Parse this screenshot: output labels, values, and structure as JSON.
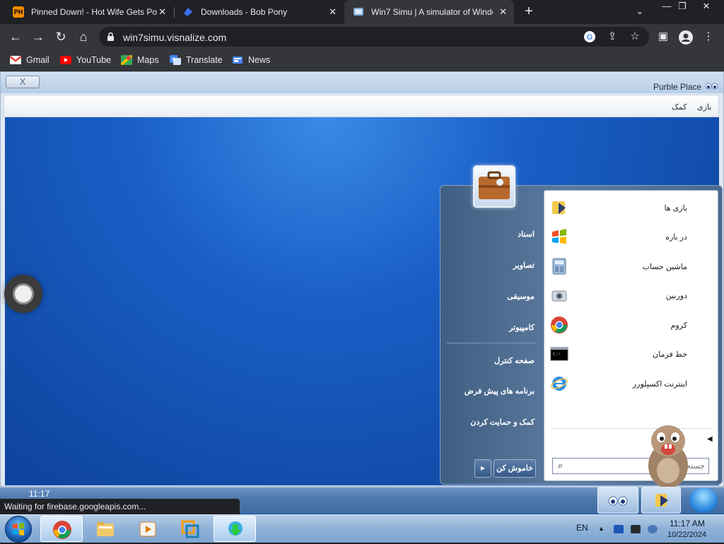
{
  "browser": {
    "tabs": [
      {
        "favicon": "pornhub-favicon",
        "title": "Pinned Down! - Hot Wife Gets Po",
        "active": false
      },
      {
        "favicon": "tumbleweed-favicon",
        "title": "Downloads - Bob Pony",
        "active": false
      },
      {
        "favicon": "win7simu-favicon",
        "title": "Win7 Simu | A simulator of Windo",
        "active": true
      }
    ],
    "new_tab": "+",
    "url": "win7simu.visnalize.com",
    "bookmarks": [
      "Gmail",
      "YouTube",
      "Maps",
      "Translate",
      "News"
    ],
    "status_text": "Waiting for firebase.googleapis.com..."
  },
  "game": {
    "close_label": "X",
    "title": "Purble Place",
    "menu": [
      "بازی",
      "کمک"
    ]
  },
  "start_menu": {
    "programs": [
      {
        "label": "بازی ها",
        "icon": "games-icon"
      },
      {
        "label": "در باره",
        "icon": "windows-flag-icon"
      },
      {
        "label": "ماشین حساب",
        "icon": "calculator-icon"
      },
      {
        "label": "دوربین",
        "icon": "camera-icon"
      },
      {
        "label": "کروم",
        "icon": "chrome-icon"
      },
      {
        "label": "خط فرمان",
        "icon": "cmd-icon"
      },
      {
        "label": "اینترنت اکسپلورر",
        "icon": "ie-icon"
      }
    ],
    "right_items": [
      "اسناد",
      "تصاویر",
      "موسیقی",
      "کامپیوتر",
      "صفحه کنترل",
      "برنامه های پیش فرض",
      "کمک و حمایت کردن"
    ],
    "search_placeholder": "جستجو برنامه ها",
    "shutdown_label": "خاموش کن"
  },
  "inner_taskbar": {
    "time": "11:17"
  },
  "taskbar": {
    "language": "EN",
    "time": "11:17 AM",
    "date": "10/22/2024"
  },
  "colors": {
    "chrome_dark": "#202124",
    "chrome_toolbar": "#35363a",
    "desktop_blue": "#1a5fc7",
    "start_menu_frame": "#4a6a8f"
  }
}
